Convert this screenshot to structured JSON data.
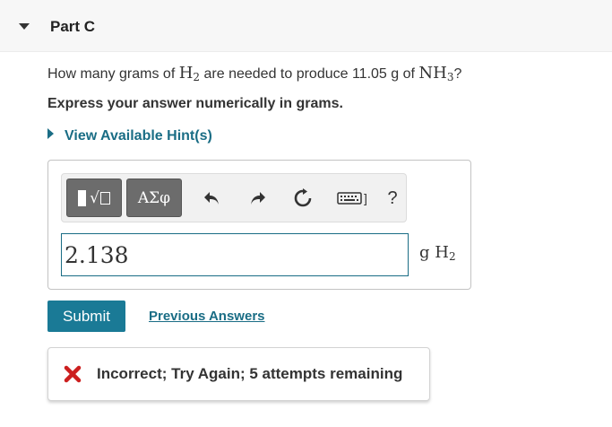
{
  "header": {
    "title": "Part C"
  },
  "question": {
    "prefix": "How many grams of ",
    "reactant_element": "H",
    "reactant_sub": "2",
    "middle": " are needed to produce 11.05 g of ",
    "product_element": "NH",
    "product_sub": "3",
    "suffix": "?"
  },
  "instruction": "Express your answer numerically in grams.",
  "hint_label": "View Available Hint(s)",
  "toolbar": {
    "symbols_label": "ΑΣφ",
    "root_glyph": "√",
    "help_label": "?",
    "keyboard_suffix": "]"
  },
  "answer": {
    "value": "2.138",
    "unit_prefix": "g ",
    "unit_element": "H",
    "unit_sub": "2"
  },
  "submit_label": "Submit",
  "previous_answers_label": "Previous Answers",
  "feedback": {
    "message": "Incorrect; Try Again; 5 attempts remaining",
    "status_color": "#cc1f1f"
  },
  "colors": {
    "accent": "#1a7a96",
    "link": "#1a6d85"
  }
}
